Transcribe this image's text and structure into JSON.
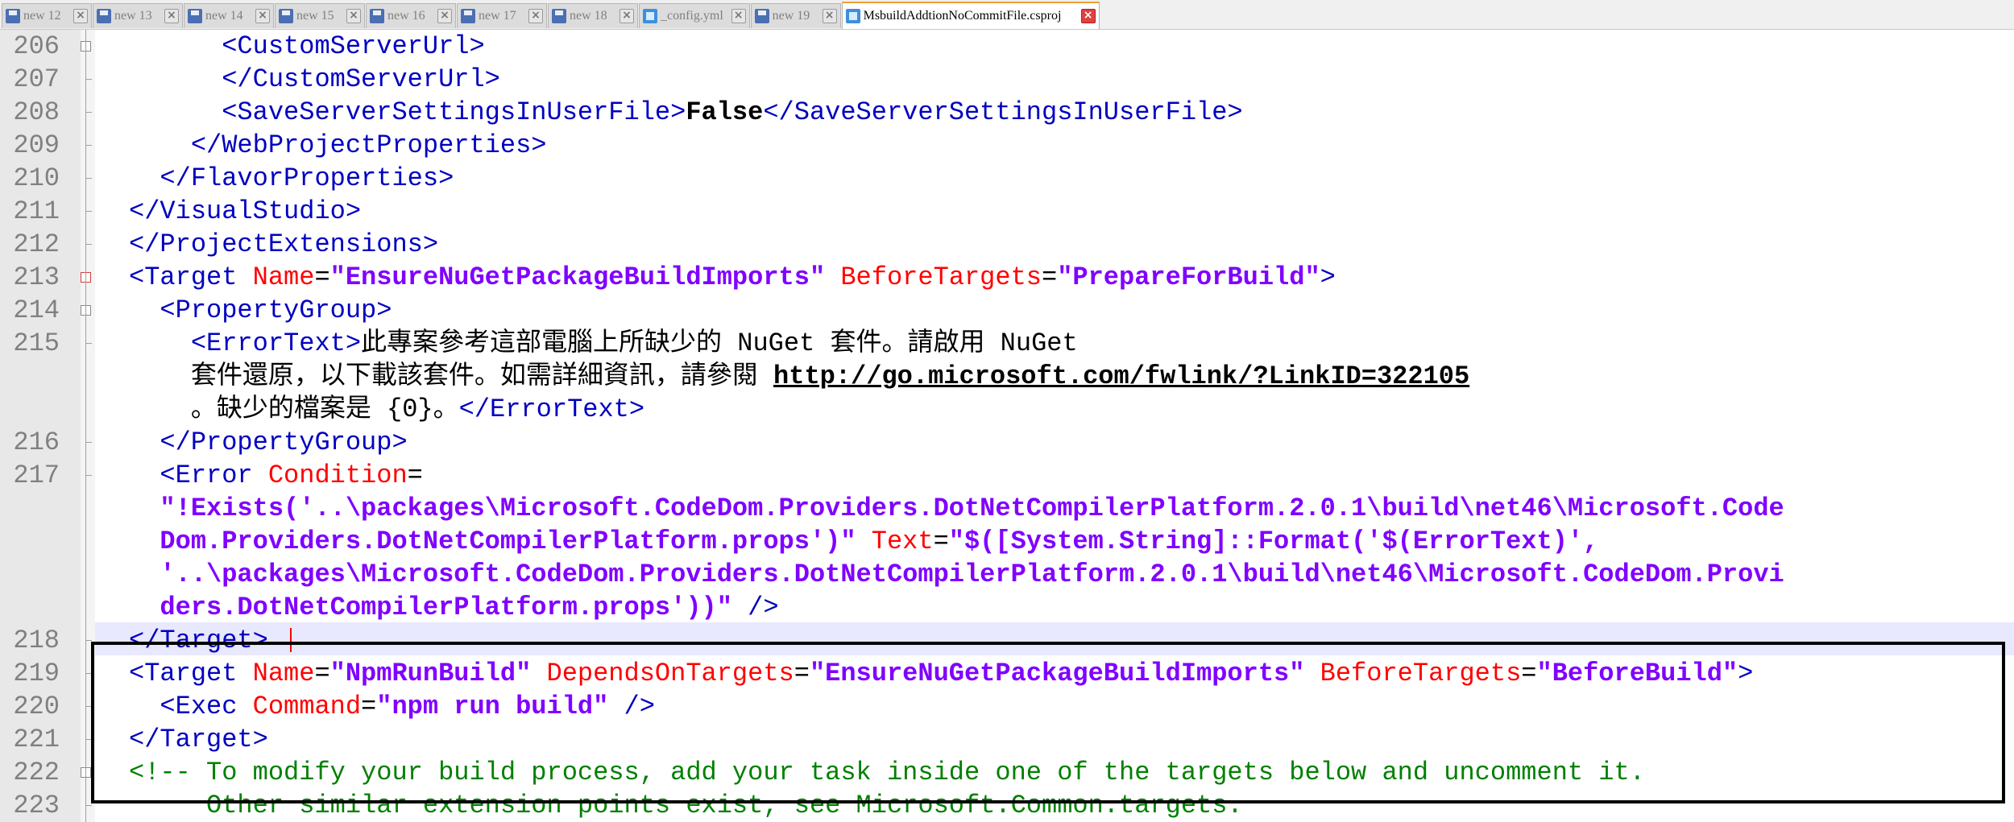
{
  "tabs": [
    {
      "label": "new 12",
      "icon": "save-icon",
      "active": false
    },
    {
      "label": "new 13",
      "icon": "save-icon",
      "active": false
    },
    {
      "label": "new 14",
      "icon": "save-icon",
      "active": false
    },
    {
      "label": "new 15",
      "icon": "save-icon",
      "active": false
    },
    {
      "label": "new 16",
      "icon": "save-icon",
      "active": false
    },
    {
      "label": "new 17",
      "icon": "save-icon",
      "active": false
    },
    {
      "label": "new 18",
      "icon": "save-icon",
      "active": false
    },
    {
      "label": "_config.yml",
      "icon": "file-icon",
      "active": false
    },
    {
      "label": "new 19",
      "icon": "save-icon",
      "active": false
    },
    {
      "label": "MsbuildAddtionNoCommitFile.csproj",
      "icon": "file-icon",
      "active": true
    }
  ],
  "tab_close_glyph": "×",
  "colors": {
    "tag": "#0000c0",
    "attribute": "#ff0000",
    "value": "#8000ff",
    "comment": "#008000",
    "current_line": "#e8e8ff",
    "highlight_box": "#000000"
  },
  "editor": {
    "lines": [
      {
        "n": "206",
        "segs": [
          [
            "tag",
            "      <CustomServerUrl>"
          ]
        ]
      },
      {
        "n": "207",
        "segs": [
          [
            "tag",
            "      </CustomServerUrl>"
          ]
        ]
      },
      {
        "n": "208",
        "segs": [
          [
            "tag",
            "      <SaveServerSettingsInUserFile>"
          ],
          [
            "bold",
            "False"
          ],
          [
            "tag",
            "</SaveServerSettingsInUserFile>"
          ]
        ]
      },
      {
        "n": "209",
        "segs": [
          [
            "tag",
            "    </WebProjectProperties>"
          ]
        ]
      },
      {
        "n": "210",
        "segs": [
          [
            "tag",
            "  </FlavorProperties>"
          ]
        ]
      },
      {
        "n": "211",
        "segs": [
          [
            "tag",
            "</VisualStudio>"
          ]
        ]
      },
      {
        "n": "212",
        "segs": [
          [
            "tag",
            "</ProjectExtensions>"
          ]
        ]
      },
      {
        "n": "213",
        "segs": [
          [
            "tag",
            "<Target"
          ],
          [
            "attr",
            " Name"
          ],
          [
            "punct",
            "="
          ],
          [
            "val",
            "\"EnsureNuGetPackageBuildImports\""
          ],
          [
            "attr",
            " BeforeTargets"
          ],
          [
            "punct",
            "="
          ],
          [
            "val",
            "\"PrepareForBuild\""
          ],
          [
            "tag",
            ">"
          ]
        ]
      },
      {
        "n": "214",
        "segs": [
          [
            "tag",
            "  <PropertyGroup>"
          ]
        ]
      },
      {
        "n": "215",
        "segs": [
          [
            "tag",
            "    <ErrorText>"
          ],
          [
            "txt",
            "此專案參考這部電腦上所缺少的 NuGet 套件。請啟用 NuGet"
          ]
        ]
      },
      {
        "n": "",
        "segs": [
          [
            "txt",
            "    套件還原，以下載該套件。如需詳細資訊，請參閱 "
          ],
          [
            "link",
            "http://go.microsoft.com/fwlink/?LinkID=322105"
          ]
        ]
      },
      {
        "n": "",
        "segs": [
          [
            "txt",
            "    。缺少的檔案是 {0}。"
          ],
          [
            "tag",
            "</ErrorText>"
          ]
        ]
      },
      {
        "n": "216",
        "segs": [
          [
            "tag",
            "  </PropertyGroup>"
          ]
        ]
      },
      {
        "n": "217",
        "segs": [
          [
            "tag",
            "  <Error"
          ],
          [
            "attr",
            " Condition"
          ],
          [
            "punct",
            "="
          ]
        ]
      },
      {
        "n": "",
        "segs": [
          [
            "val",
            "  \"!Exists('..\\packages\\Microsoft.CodeDom.Providers.DotNetCompilerPlatform.2.0.1\\build\\net46\\Microsoft.Code"
          ]
        ]
      },
      {
        "n": "",
        "segs": [
          [
            "val",
            "  Dom.Providers.DotNetCompilerPlatform.props')\""
          ],
          [
            "attr",
            " Text"
          ],
          [
            "punct",
            "="
          ],
          [
            "val",
            "\"$([System.String]::Format('$(ErrorText)',"
          ]
        ]
      },
      {
        "n": "",
        "segs": [
          [
            "val",
            "  '..\\packages\\Microsoft.CodeDom.Providers.DotNetCompilerPlatform.2.0.1\\build\\net46\\Microsoft.CodeDom.Provi"
          ]
        ]
      },
      {
        "n": "",
        "segs": [
          [
            "val",
            "  ders.DotNetCompilerPlatform.props'))\""
          ],
          [
            "tag",
            " />"
          ]
        ]
      },
      {
        "n": "218",
        "segs": [
          [
            "tag",
            "</Target>"
          ]
        ]
      },
      {
        "n": "219",
        "segs": [
          [
            "tag",
            "<Target"
          ],
          [
            "attr",
            " Name"
          ],
          [
            "punct",
            "="
          ],
          [
            "val",
            "\"NpmRunBuild\""
          ],
          [
            "attr",
            " DependsOnTargets"
          ],
          [
            "punct",
            "="
          ],
          [
            "val",
            "\"EnsureNuGetPackageBuildImports\""
          ],
          [
            "attr",
            " BeforeTargets"
          ],
          [
            "punct",
            "="
          ],
          [
            "val",
            "\"BeforeBuild\""
          ],
          [
            "tag",
            ">"
          ]
        ]
      },
      {
        "n": "220",
        "segs": [
          [
            "tag",
            "  <Exec"
          ],
          [
            "attr",
            " Command"
          ],
          [
            "punct",
            "="
          ],
          [
            "val",
            "\"npm run build\""
          ],
          [
            "tag",
            " />"
          ]
        ]
      },
      {
        "n": "221",
        "segs": [
          [
            "tag",
            "</Target>"
          ]
        ]
      },
      {
        "n": "222",
        "segs": [
          [
            "cmt",
            "<!-- To modify your build process, add your task inside one of the targets below and uncomment it."
          ]
        ]
      },
      {
        "n": "223",
        "segs": [
          [
            "cmt",
            "     Other similar extension points exist, see Microsoft.Common.targets."
          ]
        ]
      }
    ]
  }
}
